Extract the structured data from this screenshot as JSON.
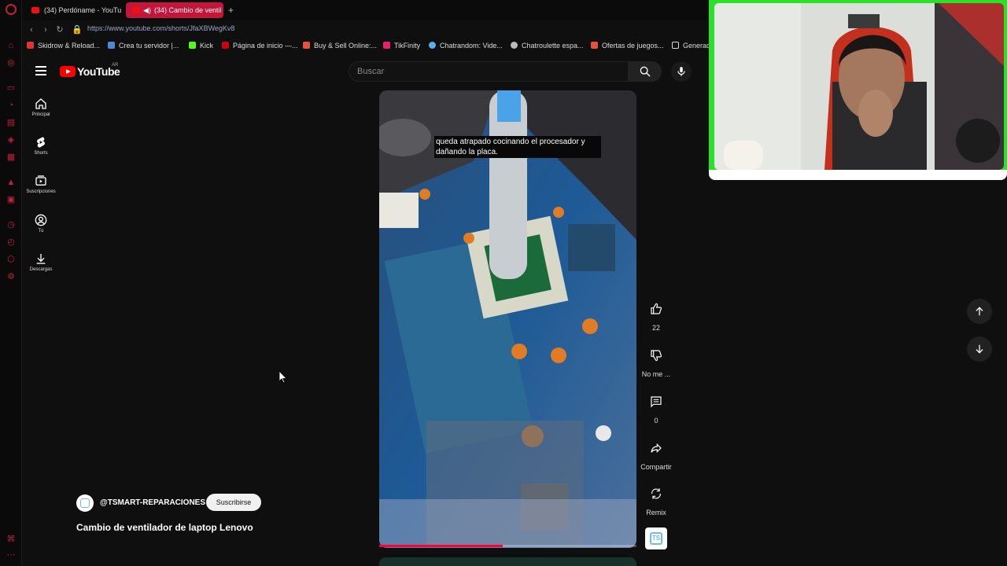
{
  "browser": {
    "tabs": [
      {
        "label": "(34) Perdóname - YouTub",
        "active": false
      },
      {
        "label": "(34) Cambio de ventil",
        "active": true
      }
    ],
    "url": "https://www.youtube.com/shorts/JfaXBWegKv8",
    "bookmarks": [
      {
        "label": "Skidrow & Reload...",
        "color": "#d33"
      },
      {
        "label": "Crea tu servidor |...",
        "color": "#4a8ad8"
      },
      {
        "label": "Kick",
        "color": "#53fc18"
      },
      {
        "label": "Página de inicio —...",
        "color": "#c01"
      },
      {
        "label": "Buy & Sell Online:...",
        "color": "#e5533c"
      },
      {
        "label": "TikFinity",
        "color": "#e4226a"
      },
      {
        "label": "Chatrandom: Vide...",
        "color": "#5ab0e8"
      },
      {
        "label": "Chatroulette espa...",
        "color": "#bbb"
      },
      {
        "label": "Ofertas de juegos...",
        "color": "#e5533c"
      },
      {
        "label": "Generad",
        "color": "#ddd"
      }
    ]
  },
  "youtube": {
    "logo_text": "YouTube",
    "country_code": "AR",
    "search_placeholder": "Buscar",
    "sidebar": [
      {
        "label": "Principal",
        "icon": "home-icon"
      },
      {
        "label": "Shorts",
        "icon": "shorts-icon"
      },
      {
        "label": "Suscripciones",
        "icon": "subscriptions-icon"
      },
      {
        "label": "Tú",
        "icon": "you-icon"
      },
      {
        "label": "Descargas",
        "icon": "download-icon"
      }
    ]
  },
  "short": {
    "caption": "queda atrapado cocinando el procesador y dañando la placa.",
    "progress": 0.48,
    "channel_handle": "@TSMART-REPARACIONES",
    "subscribe_label": "Suscribirse",
    "title": "Cambio de ventilador de laptop Lenovo",
    "actions": {
      "like_count": "22",
      "dislike_label": "No me ...",
      "comment_count": "0",
      "share_label": "Compartir",
      "remix_label": "Remix"
    }
  },
  "colors": {
    "accent_red": "#ff0033",
    "active_tab": "#c4153a",
    "webcam_border": "#2be02b"
  }
}
